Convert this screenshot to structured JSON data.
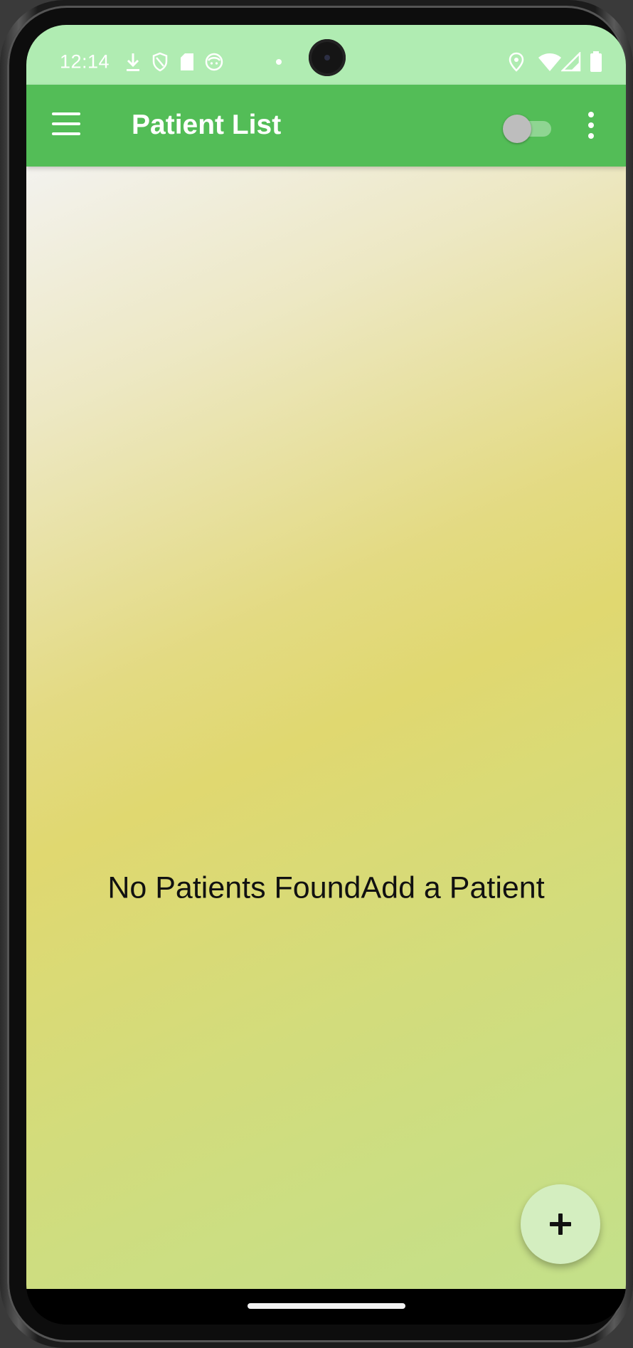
{
  "status_bar": {
    "time": "12:14",
    "left_icons": [
      "download-icon",
      "shield-icon",
      "sd-card-icon",
      "face-icon",
      "dot-icon"
    ],
    "right_icons": [
      "location-icon",
      "wifi-icon",
      "signal-icon",
      "battery-icon"
    ]
  },
  "app_bar": {
    "title": "Patient List",
    "menu_icon": "hamburger-menu-icon",
    "toggle_state": "off",
    "overflow_icon": "more-vert-icon",
    "color": "#53bd57"
  },
  "main": {
    "empty_message": "No Patients FoundAdd a Patient"
  },
  "fab": {
    "icon": "plus-icon",
    "color": "#d4eec0"
  },
  "colors": {
    "status_bar": "#b0ecb2",
    "app_bar": "#53bd57"
  }
}
